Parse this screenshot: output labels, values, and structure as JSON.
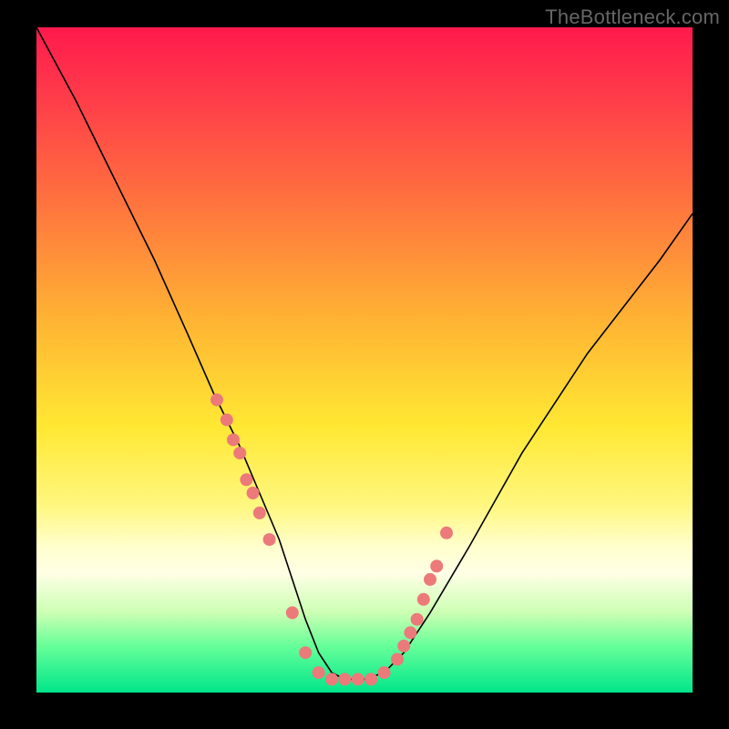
{
  "attribution": "TheBottleneck.com",
  "chart_data": {
    "type": "line",
    "title": "",
    "xlabel": "",
    "ylabel": "",
    "xlim": [
      0,
      100
    ],
    "ylim": [
      0,
      100
    ],
    "grid": false,
    "legend": false,
    "series": [
      {
        "name": "bottleneck-curve",
        "x": [
          0,
          6,
          12,
          18,
          23,
          27,
          31,
          34,
          37,
          39,
          41,
          43,
          45,
          47,
          50,
          53,
          56,
          60,
          66,
          74,
          84,
          95,
          100
        ],
        "y": [
          100,
          89,
          77,
          65,
          54,
          45,
          37,
          30,
          23,
          17,
          11,
          6,
          3,
          2,
          2,
          3,
          6,
          12,
          22,
          36,
          51,
          65,
          72
        ]
      }
    ],
    "markers": {
      "name": "highlighted-points",
      "x": [
        27.5,
        29,
        30,
        31,
        32,
        33,
        34,
        35.5,
        39,
        41,
        43,
        45,
        47,
        49,
        51,
        53,
        55,
        56,
        57,
        58,
        59,
        60,
        61,
        62.5
      ],
      "y": [
        44,
        41,
        38,
        36,
        32,
        30,
        27,
        23,
        12,
        6,
        3,
        2,
        2,
        2,
        2,
        3,
        5,
        7,
        9,
        11,
        14,
        17,
        19,
        24
      ]
    },
    "background_gradient": {
      "top": "#ff1a4d",
      "mid1": "#ffb733",
      "mid2": "#ffe833",
      "light": "#ffffe6",
      "bottom": "#00e68a"
    }
  }
}
